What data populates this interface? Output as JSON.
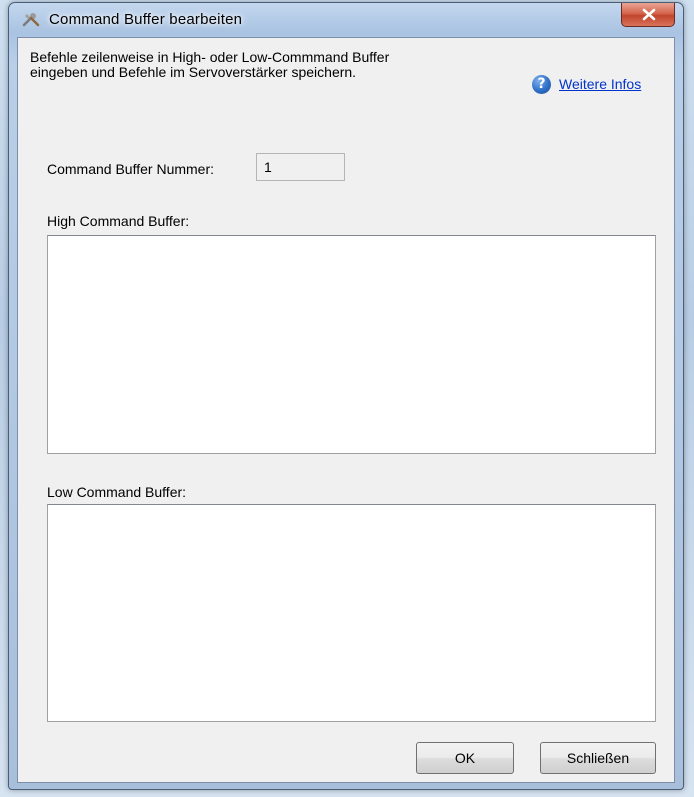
{
  "window": {
    "title": "Command Buffer bearbeiten",
    "close_label": "X"
  },
  "description": {
    "line1": "Befehle zeilenweise in High- oder Low-Commmand Buffer",
    "line2": "eingeben und Befehle im Servoverstärker speichern."
  },
  "help": {
    "icon": "help-question-icon",
    "link_text": "Weitere Infos"
  },
  "buffer_number": {
    "label": "Command Buffer Nummer:",
    "value": "1"
  },
  "high_buffer": {
    "label": "High Command Buffer:",
    "value": ""
  },
  "low_buffer": {
    "label": "Low Command Buffer:",
    "value": ""
  },
  "buttons": {
    "ok_label": "OK",
    "close_label": "Schließen"
  }
}
